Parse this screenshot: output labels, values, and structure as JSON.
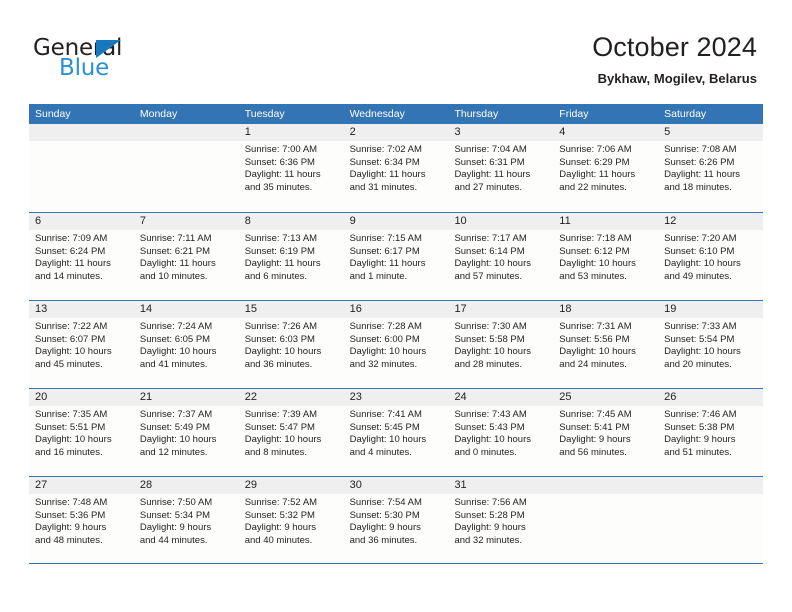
{
  "brand": {
    "name_top": "General",
    "name_bottom": "Blue",
    "triangle_color": "#1878be",
    "blue_text_color": "#2d8fd5"
  },
  "header": {
    "title": "October 2024",
    "subtitle": "Bykhaw, Mogilev, Belarus"
  },
  "theme": {
    "header_blue": "#3375b4",
    "day_band_gray": "#efeff0",
    "cell_background": "#fdfdfc",
    "text_color": "#231f20"
  },
  "weekday_headers": [
    "Sunday",
    "Monday",
    "Tuesday",
    "Wednesday",
    "Thursday",
    "Friday",
    "Saturday"
  ],
  "weeks": [
    [
      {
        "day": "",
        "sunrise": "",
        "sunset": "",
        "daylight_line1": "",
        "daylight_line2": ""
      },
      {
        "day": "",
        "sunrise": "",
        "sunset": "",
        "daylight_line1": "",
        "daylight_line2": ""
      },
      {
        "day": "1",
        "sunrise": "Sunrise: 7:00 AM",
        "sunset": "Sunset: 6:36 PM",
        "daylight_line1": "Daylight: 11 hours",
        "daylight_line2": "and 35 minutes."
      },
      {
        "day": "2",
        "sunrise": "Sunrise: 7:02 AM",
        "sunset": "Sunset: 6:34 PM",
        "daylight_line1": "Daylight: 11 hours",
        "daylight_line2": "and 31 minutes."
      },
      {
        "day": "3",
        "sunrise": "Sunrise: 7:04 AM",
        "sunset": "Sunset: 6:31 PM",
        "daylight_line1": "Daylight: 11 hours",
        "daylight_line2": "and 27 minutes."
      },
      {
        "day": "4",
        "sunrise": "Sunrise: 7:06 AM",
        "sunset": "Sunset: 6:29 PM",
        "daylight_line1": "Daylight: 11 hours",
        "daylight_line2": "and 22 minutes."
      },
      {
        "day": "5",
        "sunrise": "Sunrise: 7:08 AM",
        "sunset": "Sunset: 6:26 PM",
        "daylight_line1": "Daylight: 11 hours",
        "daylight_line2": "and 18 minutes."
      }
    ],
    [
      {
        "day": "6",
        "sunrise": "Sunrise: 7:09 AM",
        "sunset": "Sunset: 6:24 PM",
        "daylight_line1": "Daylight: 11 hours",
        "daylight_line2": "and 14 minutes."
      },
      {
        "day": "7",
        "sunrise": "Sunrise: 7:11 AM",
        "sunset": "Sunset: 6:21 PM",
        "daylight_line1": "Daylight: 11 hours",
        "daylight_line2": "and 10 minutes."
      },
      {
        "day": "8",
        "sunrise": "Sunrise: 7:13 AM",
        "sunset": "Sunset: 6:19 PM",
        "daylight_line1": "Daylight: 11 hours",
        "daylight_line2": "and 6 minutes."
      },
      {
        "day": "9",
        "sunrise": "Sunrise: 7:15 AM",
        "sunset": "Sunset: 6:17 PM",
        "daylight_line1": "Daylight: 11 hours",
        "daylight_line2": "and 1 minute."
      },
      {
        "day": "10",
        "sunrise": "Sunrise: 7:17 AM",
        "sunset": "Sunset: 6:14 PM",
        "daylight_line1": "Daylight: 10 hours",
        "daylight_line2": "and 57 minutes."
      },
      {
        "day": "11",
        "sunrise": "Sunrise: 7:18 AM",
        "sunset": "Sunset: 6:12 PM",
        "daylight_line1": "Daylight: 10 hours",
        "daylight_line2": "and 53 minutes."
      },
      {
        "day": "12",
        "sunrise": "Sunrise: 7:20 AM",
        "sunset": "Sunset: 6:10 PM",
        "daylight_line1": "Daylight: 10 hours",
        "daylight_line2": "and 49 minutes."
      }
    ],
    [
      {
        "day": "13",
        "sunrise": "Sunrise: 7:22 AM",
        "sunset": "Sunset: 6:07 PM",
        "daylight_line1": "Daylight: 10 hours",
        "daylight_line2": "and 45 minutes."
      },
      {
        "day": "14",
        "sunrise": "Sunrise: 7:24 AM",
        "sunset": "Sunset: 6:05 PM",
        "daylight_line1": "Daylight: 10 hours",
        "daylight_line2": "and 41 minutes."
      },
      {
        "day": "15",
        "sunrise": "Sunrise: 7:26 AM",
        "sunset": "Sunset: 6:03 PM",
        "daylight_line1": "Daylight: 10 hours",
        "daylight_line2": "and 36 minutes."
      },
      {
        "day": "16",
        "sunrise": "Sunrise: 7:28 AM",
        "sunset": "Sunset: 6:00 PM",
        "daylight_line1": "Daylight: 10 hours",
        "daylight_line2": "and 32 minutes."
      },
      {
        "day": "17",
        "sunrise": "Sunrise: 7:30 AM",
        "sunset": "Sunset: 5:58 PM",
        "daylight_line1": "Daylight: 10 hours",
        "daylight_line2": "and 28 minutes."
      },
      {
        "day": "18",
        "sunrise": "Sunrise: 7:31 AM",
        "sunset": "Sunset: 5:56 PM",
        "daylight_line1": "Daylight: 10 hours",
        "daylight_line2": "and 24 minutes."
      },
      {
        "day": "19",
        "sunrise": "Sunrise: 7:33 AM",
        "sunset": "Sunset: 5:54 PM",
        "daylight_line1": "Daylight: 10 hours",
        "daylight_line2": "and 20 minutes."
      }
    ],
    [
      {
        "day": "20",
        "sunrise": "Sunrise: 7:35 AM",
        "sunset": "Sunset: 5:51 PM",
        "daylight_line1": "Daylight: 10 hours",
        "daylight_line2": "and 16 minutes."
      },
      {
        "day": "21",
        "sunrise": "Sunrise: 7:37 AM",
        "sunset": "Sunset: 5:49 PM",
        "daylight_line1": "Daylight: 10 hours",
        "daylight_line2": "and 12 minutes."
      },
      {
        "day": "22",
        "sunrise": "Sunrise: 7:39 AM",
        "sunset": "Sunset: 5:47 PM",
        "daylight_line1": "Daylight: 10 hours",
        "daylight_line2": "and 8 minutes."
      },
      {
        "day": "23",
        "sunrise": "Sunrise: 7:41 AM",
        "sunset": "Sunset: 5:45 PM",
        "daylight_line1": "Daylight: 10 hours",
        "daylight_line2": "and 4 minutes."
      },
      {
        "day": "24",
        "sunrise": "Sunrise: 7:43 AM",
        "sunset": "Sunset: 5:43 PM",
        "daylight_line1": "Daylight: 10 hours",
        "daylight_line2": "and 0 minutes."
      },
      {
        "day": "25",
        "sunrise": "Sunrise: 7:45 AM",
        "sunset": "Sunset: 5:41 PM",
        "daylight_line1": "Daylight: 9 hours",
        "daylight_line2": "and 56 minutes."
      },
      {
        "day": "26",
        "sunrise": "Sunrise: 7:46 AM",
        "sunset": "Sunset: 5:38 PM",
        "daylight_line1": "Daylight: 9 hours",
        "daylight_line2": "and 51 minutes."
      }
    ],
    [
      {
        "day": "27",
        "sunrise": "Sunrise: 7:48 AM",
        "sunset": "Sunset: 5:36 PM",
        "daylight_line1": "Daylight: 9 hours",
        "daylight_line2": "and 48 minutes."
      },
      {
        "day": "28",
        "sunrise": "Sunrise: 7:50 AM",
        "sunset": "Sunset: 5:34 PM",
        "daylight_line1": "Daylight: 9 hours",
        "daylight_line2": "and 44 minutes."
      },
      {
        "day": "29",
        "sunrise": "Sunrise: 7:52 AM",
        "sunset": "Sunset: 5:32 PM",
        "daylight_line1": "Daylight: 9 hours",
        "daylight_line2": "and 40 minutes."
      },
      {
        "day": "30",
        "sunrise": "Sunrise: 7:54 AM",
        "sunset": "Sunset: 5:30 PM",
        "daylight_line1": "Daylight: 9 hours",
        "daylight_line2": "and 36 minutes."
      },
      {
        "day": "31",
        "sunrise": "Sunrise: 7:56 AM",
        "sunset": "Sunset: 5:28 PM",
        "daylight_line1": "Daylight: 9 hours",
        "daylight_line2": "and 32 minutes."
      },
      {
        "day": "",
        "sunrise": "",
        "sunset": "",
        "daylight_line1": "",
        "daylight_line2": ""
      },
      {
        "day": "",
        "sunrise": "",
        "sunset": "",
        "daylight_line1": "",
        "daylight_line2": ""
      }
    ]
  ]
}
